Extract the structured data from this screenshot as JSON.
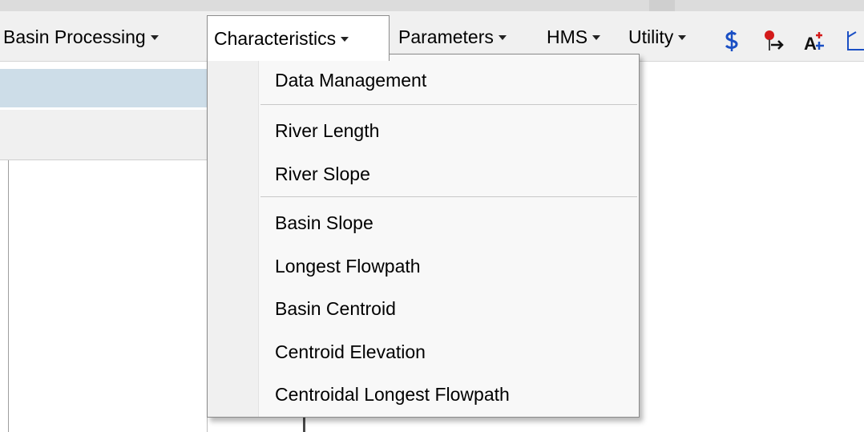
{
  "menubar": {
    "items": [
      {
        "label": "Basin Processing"
      },
      {
        "label": "Characteristics"
      },
      {
        "label": "Parameters"
      },
      {
        "label": "HMS"
      },
      {
        "label": "Utility"
      }
    ],
    "tools": [
      {
        "icon": "dollar-symbol-icon"
      },
      {
        "icon": "pin-arrow-icon"
      },
      {
        "icon": "text-add-icon"
      },
      {
        "icon": "axis-icon"
      }
    ]
  },
  "dropdown": {
    "items": [
      {
        "label": "Data Management"
      },
      {
        "label": "River Length"
      },
      {
        "label": "River Slope"
      },
      {
        "label": "Basin Slope"
      },
      {
        "label": "Longest Flowpath"
      },
      {
        "label": "Basin Centroid"
      },
      {
        "label": "Centroid Elevation"
      },
      {
        "label": "Centroidal Longest Flowpath"
      }
    ]
  },
  "colors": {
    "toolbar_bg": "#f0f0f0",
    "menu_bg": "#f8f8f8",
    "highlight": "#cddde8",
    "icon_blue": "#1a4fc4",
    "icon_red": "#d31a1a"
  }
}
